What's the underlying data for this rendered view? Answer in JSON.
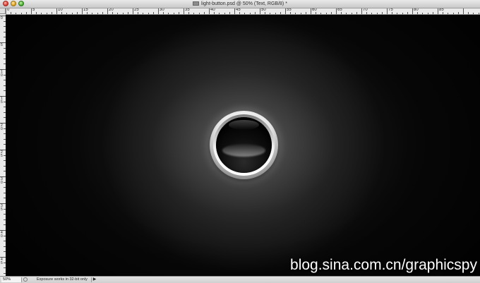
{
  "window": {
    "title": "light-button.psd @ 50% (Text, RGB/8) *"
  },
  "ruler": {
    "top_labels": [
      "0",
      "5",
      "10",
      "15",
      "20",
      "25",
      "30",
      "35",
      "40",
      "45",
      "50",
      "55",
      "60",
      "65",
      "70",
      "75",
      "80",
      "85"
    ],
    "left_labels": [
      "0",
      "5",
      "10",
      "15",
      "20",
      "25",
      "30",
      "35",
      "40",
      "45"
    ]
  },
  "canvas": {
    "watermark": "blog.sina.com.cn/graphicspy",
    "background_color": "#000000",
    "glow_color": "#5e5e5e"
  },
  "statusbar": {
    "zoom": "50%",
    "message": "Exposure works in 32-bit only",
    "arrow": "▶"
  }
}
